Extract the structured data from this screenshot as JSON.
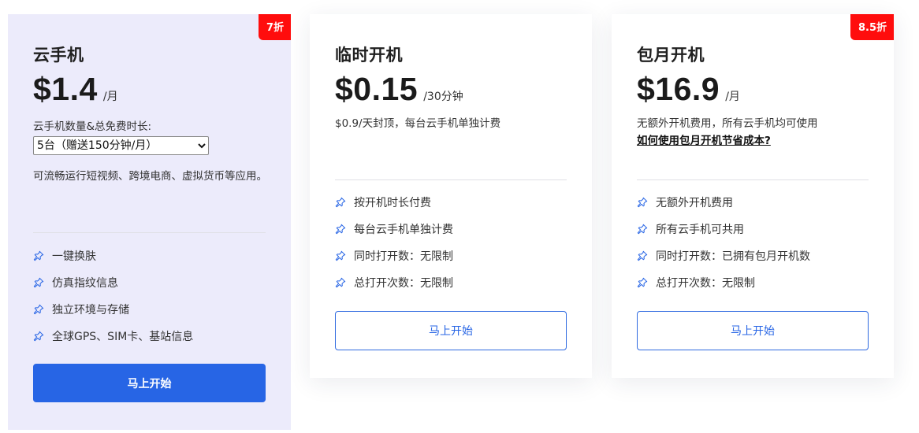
{
  "accent_color": "#2765e5",
  "badge_color": "#ff0d0d",
  "feature_icon": "pin-icon",
  "plans": [
    {
      "name": "云手机",
      "price": "$1.4",
      "unit": "/月",
      "badge": "7折",
      "select_label": "云手机数量&总免费时长:",
      "select_value": "5台（赠送150分钟/月）",
      "description": "可流畅运行短视频、跨境电商、虚拟货币等应用。",
      "features": [
        "一键换肤",
        "仿真指纹信息",
        "独立环境与存储",
        "全球GPS、SIM卡、基站信息"
      ],
      "cta": "马上开始"
    },
    {
      "name": "临时开机",
      "price": "$0.15",
      "unit": "/30分钟",
      "description": "$0.9/天封顶，每台云手机单独计费",
      "features": [
        "按开机时长付费",
        "每台云手机单独计费",
        "同时打开数：无限制",
        "总打开次数：无限制"
      ],
      "cta": "马上开始"
    },
    {
      "name": "包月开机",
      "price": "$16.9",
      "unit": "/月",
      "badge": "8.5折",
      "description": "无额外开机费用，所有云手机均可使用",
      "link": "如何使用包月开机节省成本?",
      "features": [
        "无额外开机费用",
        "所有云手机可共用",
        "同时打开数：已拥有包月开机数",
        "总打开次数：无限制"
      ],
      "cta": "马上开始"
    }
  ]
}
